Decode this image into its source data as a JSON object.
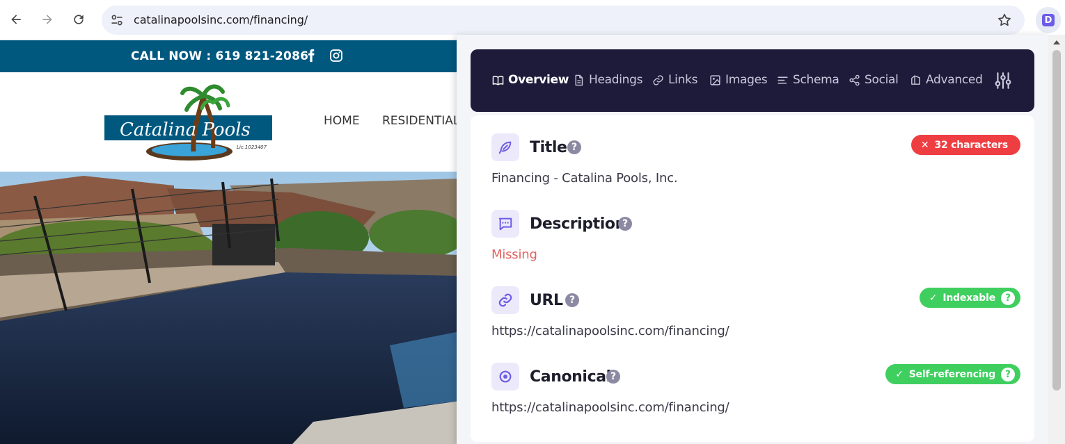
{
  "browser": {
    "url": "catalinapoolsinc.com/financing/",
    "extension_letter": "D"
  },
  "site": {
    "call_text": "CALL NOW : 619 821-2086",
    "logo_name": "Catalina Pools",
    "logo_license": "Lic.1023407",
    "menu": [
      "HOME",
      "RESIDENTIAL"
    ]
  },
  "panel": {
    "tabs": [
      {
        "label": "Overview",
        "icon": "book-icon"
      },
      {
        "label": "Headings",
        "icon": "document-icon"
      },
      {
        "label": "Links",
        "icon": "link-icon"
      },
      {
        "label": "Images",
        "icon": "image-icon"
      },
      {
        "label": "Schema",
        "icon": "schema-icon"
      },
      {
        "label": "Social",
        "icon": "share-icon"
      },
      {
        "label": "Advanced",
        "icon": "advanced-icon"
      }
    ],
    "title": {
      "label": "Title",
      "badge": "32 characters",
      "value": "Financing - Catalina Pools, Inc."
    },
    "description": {
      "label": "Description",
      "value": "Missing"
    },
    "url": {
      "label": "URL",
      "badge": "Indexable",
      "value": "https://catalinapoolsinc.com/financing/"
    },
    "canonical": {
      "label": "Canonical",
      "badge": "Self-referencing",
      "value": "https://catalinapoolsinc.com/financing/"
    }
  },
  "colors": {
    "accent": "#6c5ce7",
    "topbar": "#00587f",
    "tabs_bg": "#1e1b3a",
    "error": "#ef3e42",
    "success": "#3fcf5f"
  }
}
